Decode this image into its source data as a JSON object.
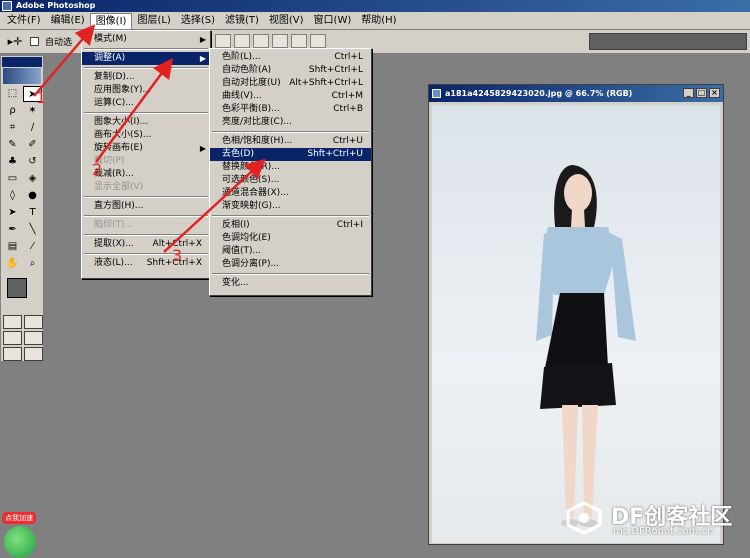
{
  "window": {
    "title": "Adobe Photoshop"
  },
  "menubar": [
    "文件(F)",
    "编辑(E)",
    "图像(I)",
    "图层(L)",
    "选择(S)",
    "滤镜(T)",
    "视图(V)",
    "窗口(W)",
    "帮助(H)"
  ],
  "optionsbar": {
    "auto_select_label": "自动选"
  },
  "image_menu": [
    {
      "label": "模式(M)",
      "arrow": true
    },
    {
      "sep": true
    },
    {
      "label": "调整(A)",
      "arrow": true,
      "highlight": true
    },
    {
      "sep": true
    },
    {
      "label": "复制(D)..."
    },
    {
      "label": "应用图象(Y)..."
    },
    {
      "label": "运算(C)..."
    },
    {
      "sep": true
    },
    {
      "label": "图象大小(I)..."
    },
    {
      "label": "画布大小(S)..."
    },
    {
      "label": "旋转画布(E)",
      "arrow": true
    },
    {
      "label": "裁切(P)",
      "disabled": true
    },
    {
      "label": "裁减(R)..."
    },
    {
      "label": "显示全部(V)",
      "disabled": true
    },
    {
      "sep": true
    },
    {
      "label": "直方图(H)..."
    },
    {
      "sep": true
    },
    {
      "label": "陷印(T)...",
      "disabled": true
    },
    {
      "sep": true
    },
    {
      "label": "提取(X)...",
      "shortcut": "Alt+Ctrl+X"
    },
    {
      "sep": true
    },
    {
      "label": "液态(L)...",
      "shortcut": "Shft+Ctrl+X"
    }
  ],
  "adjust_menu": [
    {
      "label": "色阶(L)...",
      "shortcut": "Ctrl+L"
    },
    {
      "label": "自动色阶(A)",
      "shortcut": "Shft+Ctrl+L"
    },
    {
      "label": "自动对比度(U)",
      "shortcut": "Alt+Shft+Ctrl+L"
    },
    {
      "label": "曲线(V)...",
      "shortcut": "Ctrl+M"
    },
    {
      "label": "色彩平衡(B)...",
      "shortcut": "Ctrl+B"
    },
    {
      "label": "亮度/对比度(C)..."
    },
    {
      "sep": true
    },
    {
      "label": "色相/饱和度(H)...",
      "shortcut": "Ctrl+U"
    },
    {
      "label": "去色(D)",
      "shortcut": "Shft+Ctrl+U",
      "highlight": true
    },
    {
      "label": "替换颜色(R)..."
    },
    {
      "label": "可选颜色(S)..."
    },
    {
      "label": "通道混合器(X)..."
    },
    {
      "label": "渐变映射(G)..."
    },
    {
      "sep": true
    },
    {
      "label": "反相(I)",
      "shortcut": "Ctrl+I"
    },
    {
      "label": "色调均化(E)"
    },
    {
      "label": "阈值(T)..."
    },
    {
      "label": "色调分离(P)..."
    },
    {
      "sep": true
    },
    {
      "label": "变化..."
    }
  ],
  "document": {
    "title": "a181a4245829423020.jpg @ 66.7% (RGB)"
  },
  "watermark": {
    "title": "DF创客社区",
    "url": "mc.DFRobot.com.cn"
  },
  "badge": {
    "text": "点我加速"
  },
  "annotations": [
    "1",
    "2",
    "3"
  ],
  "colors": {
    "titlebar": "#0a246a",
    "menu_bg": "#d4d0c8",
    "highlight": "#0a246a",
    "annotation": "#e22222"
  }
}
